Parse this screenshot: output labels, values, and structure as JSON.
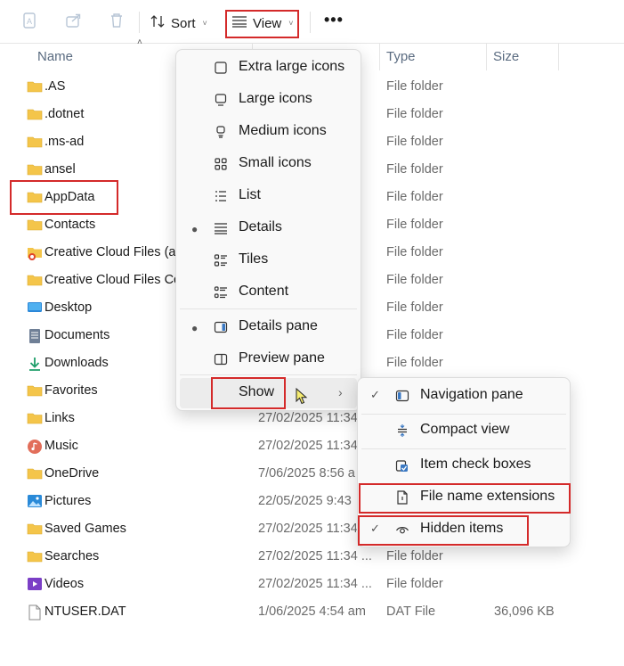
{
  "toolbar": {
    "sort_label": "Sort",
    "view_label": "View",
    "more_label": "•••"
  },
  "columns": {
    "name": "Name",
    "type": "Type",
    "size": "Size"
  },
  "rows": [
    {
      "name": ".AS",
      "date": "",
      "type": "File folder",
      "size": "",
      "icon": "folder-icon"
    },
    {
      "name": ".dotnet",
      "date": "",
      "type": "File folder",
      "size": "",
      "icon": "folder-icon"
    },
    {
      "name": ".ms-ad",
      "date": "",
      "type": "File folder",
      "size": "",
      "icon": "folder-icon"
    },
    {
      "name": "ansel",
      "date": "",
      "type": "File folder",
      "size": "",
      "icon": "folder-icon"
    },
    {
      "name": "AppData",
      "date": "",
      "type": "File folder",
      "size": "",
      "icon": "folder-icon"
    },
    {
      "name": "Contacts",
      "date": "",
      "type": "File folder",
      "size": "",
      "icon": "folder-icon"
    },
    {
      "name": "Creative Cloud Files (a",
      "date": "",
      "type": "File folder",
      "size": "",
      "icon": "creative-cloud-folder-icon"
    },
    {
      "name": "Creative Cloud Files Co",
      "date": "",
      "type": "File folder",
      "size": "",
      "icon": "folder-icon"
    },
    {
      "name": "Desktop",
      "date": "",
      "type": "File folder",
      "size": "",
      "icon": "desktop-icon"
    },
    {
      "name": "Documents",
      "date": "",
      "type": "File folder",
      "size": "",
      "icon": "documents-icon"
    },
    {
      "name": "Downloads",
      "date": "",
      "type": "File folder",
      "size": "",
      "icon": "downloads-icon"
    },
    {
      "name": "Favorites",
      "date": "",
      "type": "",
      "size": "",
      "icon": "folder-icon"
    },
    {
      "name": "Links",
      "date": "27/02/2025 11:34",
      "type": "",
      "size": "",
      "icon": "folder-icon"
    },
    {
      "name": "Music",
      "date": "27/02/2025 11:34",
      "type": "",
      "size": "",
      "icon": "music-icon"
    },
    {
      "name": "OneDrive",
      "date": "7/06/2025 8:56 a",
      "type": "",
      "size": "",
      "icon": "folder-icon"
    },
    {
      "name": "Pictures",
      "date": "22/05/2025 9:43",
      "type": "",
      "size": "",
      "icon": "pictures-icon"
    },
    {
      "name": "Saved Games",
      "date": "27/02/2025 11:34",
      "type": "",
      "size": "",
      "icon": "folder-icon"
    },
    {
      "name": "Searches",
      "date": "27/02/2025 11:34 ...",
      "type": "File folder",
      "size": "",
      "icon": "folder-icon"
    },
    {
      "name": "Videos",
      "date": "27/02/2025 11:34 ...",
      "type": "File folder",
      "size": "",
      "icon": "videos-icon"
    },
    {
      "name": "NTUSER.DAT",
      "date": "1/06/2025 4:54 am",
      "type": "DAT File",
      "size": "36,096 KB",
      "icon": "file-icon"
    }
  ],
  "view_menu": {
    "items": [
      {
        "label": "Extra large icons",
        "icon": "extra-large-icons-icon",
        "selected": false
      },
      {
        "label": "Large icons",
        "icon": "large-icons-icon",
        "selected": false
      },
      {
        "label": "Medium icons",
        "icon": "medium-icons-icon",
        "selected": false
      },
      {
        "label": "Small icons",
        "icon": "small-icons-icon",
        "selected": false
      },
      {
        "label": "List",
        "icon": "list-icon",
        "selected": false
      },
      {
        "label": "Details",
        "icon": "details-icon",
        "selected": true
      },
      {
        "label": "Tiles",
        "icon": "tiles-icon",
        "selected": false
      },
      {
        "label": "Content",
        "icon": "content-icon",
        "selected": false
      }
    ],
    "panes": [
      {
        "label": "Details pane",
        "icon": "details-pane-icon",
        "selected": true
      },
      {
        "label": "Preview pane",
        "icon": "preview-pane-icon",
        "selected": false
      }
    ],
    "show_label": "Show"
  },
  "show_menu": {
    "items": [
      {
        "label": "Navigation pane",
        "icon": "navigation-pane-icon",
        "checked": true
      },
      {
        "label": "Compact view",
        "icon": "compact-view-icon",
        "checked": false
      },
      {
        "label": "Item check boxes",
        "icon": "item-check-boxes-icon",
        "checked": false
      },
      {
        "label": "File name extensions",
        "icon": "file-name-extensions-icon",
        "checked": false
      },
      {
        "label": "Hidden items",
        "icon": "hidden-items-icon",
        "checked": true
      }
    ]
  },
  "colors": {
    "highlight_box": "#d42a2a",
    "folder": "#f4c54a",
    "accent": "#1f6fc9"
  }
}
